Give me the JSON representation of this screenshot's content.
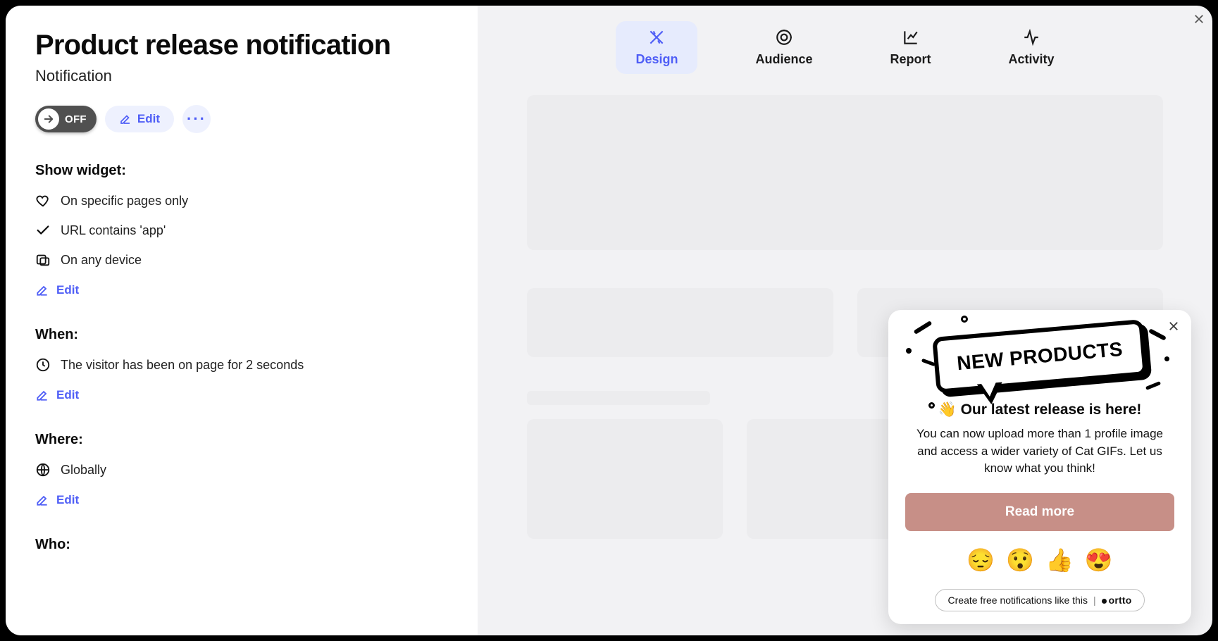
{
  "sidebar": {
    "title": "Product release notification",
    "subtitle": "Notification",
    "toggle_label": "OFF",
    "edit_label": "Edit",
    "edit_link_label": "Edit",
    "sections": [
      {
        "heading": "Show widget:",
        "items": [
          "On specific pages only",
          "URL contains 'app'",
          "On any device"
        ]
      },
      {
        "heading": "When:",
        "items": [
          "The visitor has been on page for 2 seconds"
        ]
      },
      {
        "heading": "Where:",
        "items": [
          "Globally"
        ]
      },
      {
        "heading": "Who:",
        "items": []
      }
    ]
  },
  "tabs": [
    "Design",
    "Audience",
    "Report",
    "Activity"
  ],
  "active_tab": "Design",
  "popup": {
    "hero_text": "NEW PRODUCTS",
    "title": "👋 Our latest release is here!",
    "body": "You can now upload more than 1 profile image and access a wider variety of Cat GIFs. Let us know what you think!",
    "cta": "Read more",
    "emojis": [
      "😔",
      "😯",
      "👍",
      "😍"
    ],
    "branding_text": "Create free notifications like this",
    "branding_logo": "ortto"
  },
  "colors": {
    "accent": "#4f5ef6",
    "cta_bg": "#c78f87",
    "toggle_bg": "#505050"
  }
}
